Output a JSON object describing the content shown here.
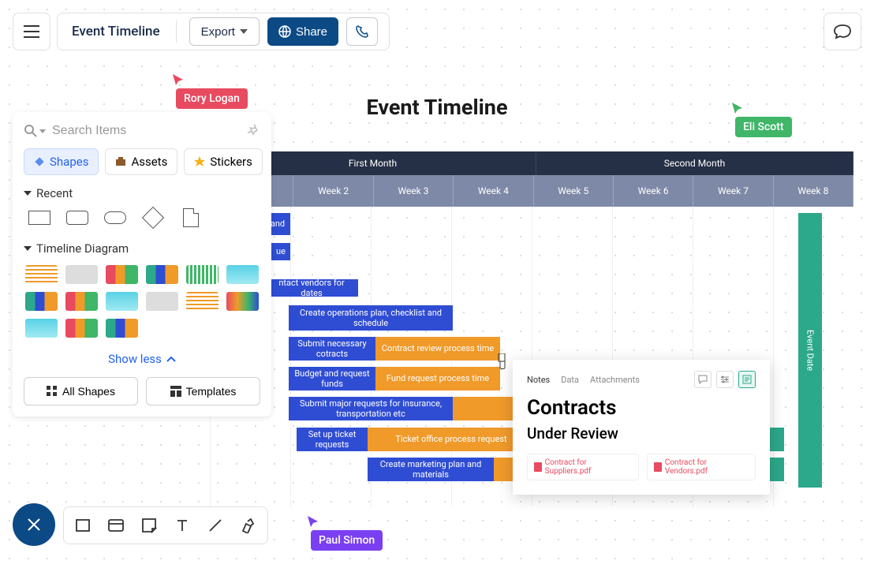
{
  "header": {
    "doc_title": "Event Timeline",
    "export_label": "Export",
    "share_label": "Share"
  },
  "canvas": {
    "title": "Event Timeline"
  },
  "cursors": {
    "rory": "Rory Logan",
    "eli": "Eli Scott",
    "paul": "Paul Simon"
  },
  "sidebar": {
    "search_placeholder": "Search Items",
    "tabs": {
      "shapes": "Shapes",
      "assets": "Assets",
      "stickers": "Stickers"
    },
    "recent_label": "Recent",
    "timeline_label": "Timeline Diagram",
    "show_less": "Show less",
    "all_shapes": "All Shapes",
    "templates": "Templates"
  },
  "timeline": {
    "months": {
      "m1": "First Month",
      "m2": "Second Month"
    },
    "weeks": {
      "w2": "Week 2",
      "w3": "Week 3",
      "w4": "Week 4",
      "w5": "Week 5",
      "w6": "Week 6",
      "w7": "Week 7",
      "w8": "Week 8"
    },
    "bars": {
      "b_and": "and",
      "b_ue": "ue",
      "b_vendors": "ntact vendors for dates",
      "b_ops": "Create operations plan, checklist and schedule",
      "b_submit_contracts": "Submit necessary cotracts",
      "b_contract_review": "Contract review process time",
      "b_budget": "Budget and request funds",
      "b_fund_review": "Fund request process time",
      "b_insurance": "Submit major requests for insurance, transportation etc",
      "b_tickets": "Set up ticket requests",
      "b_ticket_review": "Ticket office process request",
      "b_marketing": "Create marketing plan and materials",
      "b_eventdate": "Event Date"
    }
  },
  "popup": {
    "tabs": {
      "notes": "Notes",
      "data": "Data",
      "attachments": "Attachments"
    },
    "title": "Contracts",
    "subtitle": "Under Review",
    "pdf1": "Contract for Suppliers.pdf",
    "pdf2": "Contract for Vendors.pdf"
  }
}
